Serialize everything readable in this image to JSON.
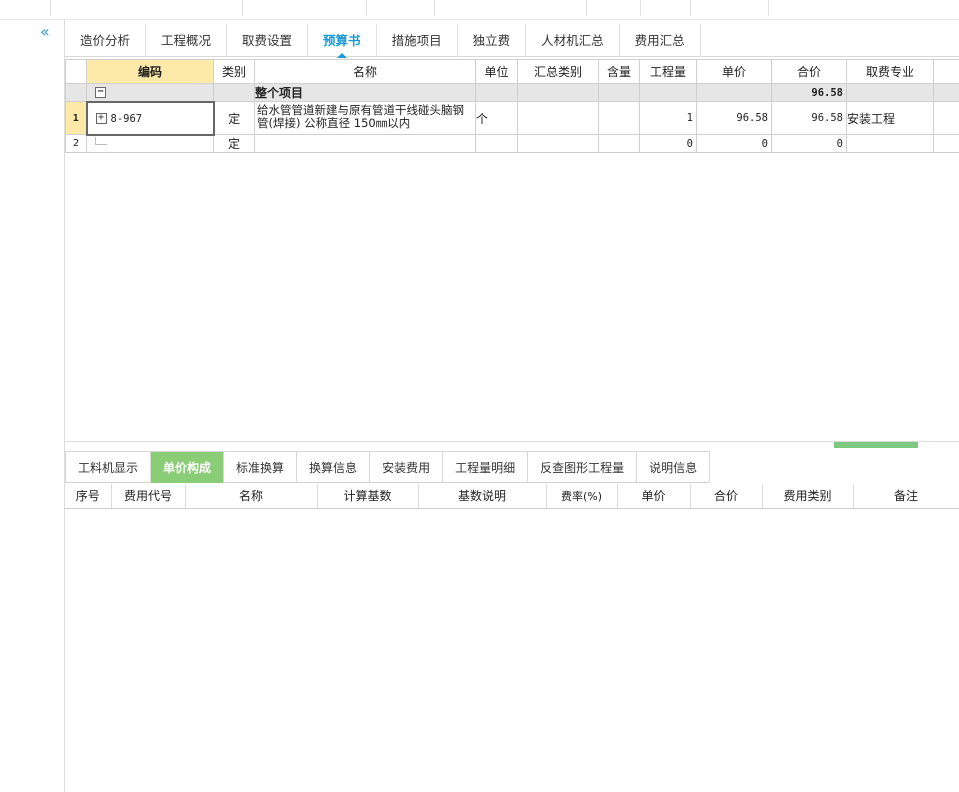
{
  "sidebar": {
    "collapse_glyph": "«"
  },
  "tabs": [
    "造价分析",
    "工程概况",
    "取费设置",
    "预算书",
    "措施项目",
    "独立费",
    "人材机汇总",
    "费用汇总"
  ],
  "grid": {
    "headers": [
      "",
      "编码",
      "类别",
      "名称",
      "单位",
      "汇总类别",
      "含量",
      "工程量",
      "单价",
      "合价",
      "取费专业",
      ""
    ],
    "group": {
      "toggle": "−",
      "name": "整个项目",
      "total": "96.58"
    },
    "rows": [
      {
        "index": "1",
        "toggle": "+",
        "code": "8-967",
        "type": "定",
        "name": "给水管管道新建与原有管道干线碰头脑钢管(焊接) 公称直径 150㎜以内",
        "unit": "个",
        "qty": "1",
        "price": "96.58",
        "total": "96.58",
        "specialty": "安装工程"
      },
      {
        "index": "2",
        "toggle": "",
        "code": "",
        "type": "定",
        "name": "",
        "unit": "",
        "qty": "0",
        "price": "0",
        "total": "0",
        "specialty": ""
      }
    ]
  },
  "bottom_tabs": [
    "工料机显示",
    "单价构成",
    "标准换算",
    "换算信息",
    "安装费用",
    "工程量明细",
    "反查图形工程量",
    "说明信息"
  ],
  "bottom_grid": {
    "headers": [
      "序号",
      "费用代号",
      "名称",
      "计算基数",
      "基数说明",
      "费率(%)",
      "单价",
      "合价",
      "费用类别",
      "备注"
    ]
  }
}
